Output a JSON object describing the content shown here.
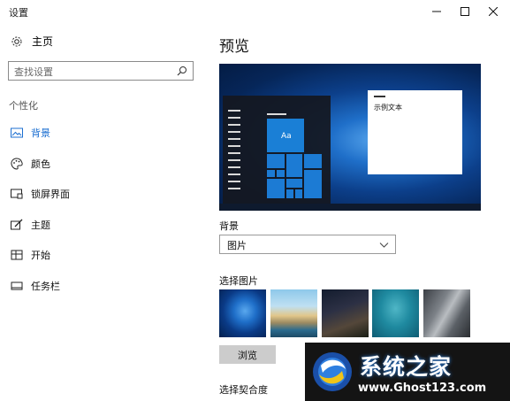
{
  "window": {
    "title": "设置",
    "minimize_icon": "minimize-icon",
    "maximize_icon": "maximize-icon",
    "close_icon": "close-icon"
  },
  "sidebar": {
    "home_label": "主页",
    "home_icon": "gear-icon",
    "search_placeholder": "查找设置",
    "search_icon": "search-icon",
    "section_label": "个性化",
    "items": [
      {
        "label": "背景",
        "icon": "image-icon",
        "active": true
      },
      {
        "label": "颜色",
        "icon": "palette-icon",
        "active": false
      },
      {
        "label": "锁屏界面",
        "icon": "lock-screen-icon",
        "active": false
      },
      {
        "label": "主题",
        "icon": "brush-icon",
        "active": false
      },
      {
        "label": "开始",
        "icon": "start-menu-icon",
        "active": false
      },
      {
        "label": "任务栏",
        "icon": "taskbar-icon",
        "active": false
      }
    ],
    "accent_color": "#1c6fd1"
  },
  "main": {
    "preview_title": "预览",
    "preview": {
      "tile_text": "Aa",
      "sample_text": "示例文本"
    },
    "background_label": "背景",
    "background_value": "图片",
    "choose_picture_label": "选择图片",
    "browse_label": "浏览",
    "choose_fit_label": "选择契合度"
  },
  "watermark": {
    "title": "系统之家",
    "url": "www.Ghost123.com"
  }
}
